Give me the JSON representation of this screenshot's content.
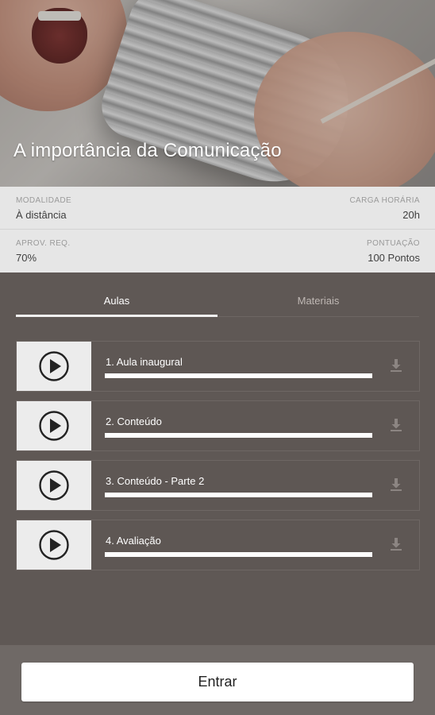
{
  "course": {
    "title": "A importância da Comunicação"
  },
  "info": {
    "modalidade_label": "MODALIDADE",
    "modalidade_value": "À distância",
    "carga_label": "CARGA HORÁRIA",
    "carga_value": "20h",
    "aprov_label": "APROV. REQ.",
    "aprov_value": "70%",
    "pontuacao_label": "PONTUAÇÃO",
    "pontuacao_value": "100 Pontos"
  },
  "tabs": [
    {
      "label": "Aulas",
      "active": true
    },
    {
      "label": "Materiais",
      "active": false
    }
  ],
  "lessons": [
    {
      "title": "1. Aula inaugural",
      "progress": 1.0,
      "icon": "play-icon",
      "action_icon": "download-icon"
    },
    {
      "title": "2. Conteúdo",
      "progress": 1.0,
      "icon": "play-icon",
      "action_icon": "download-icon"
    },
    {
      "title": "3. Conteúdo - Parte 2",
      "progress": 1.0,
      "icon": "play-icon",
      "action_icon": "download-icon"
    },
    {
      "title": "4. Avaliação",
      "progress": 1.0,
      "icon": "play-icon",
      "action_icon": "download-icon"
    }
  ],
  "enter_button": {
    "label": "Entrar"
  },
  "colors": {
    "background": "#5f5855",
    "info_background": "#e6e6e6",
    "accent": "#ffffff"
  }
}
